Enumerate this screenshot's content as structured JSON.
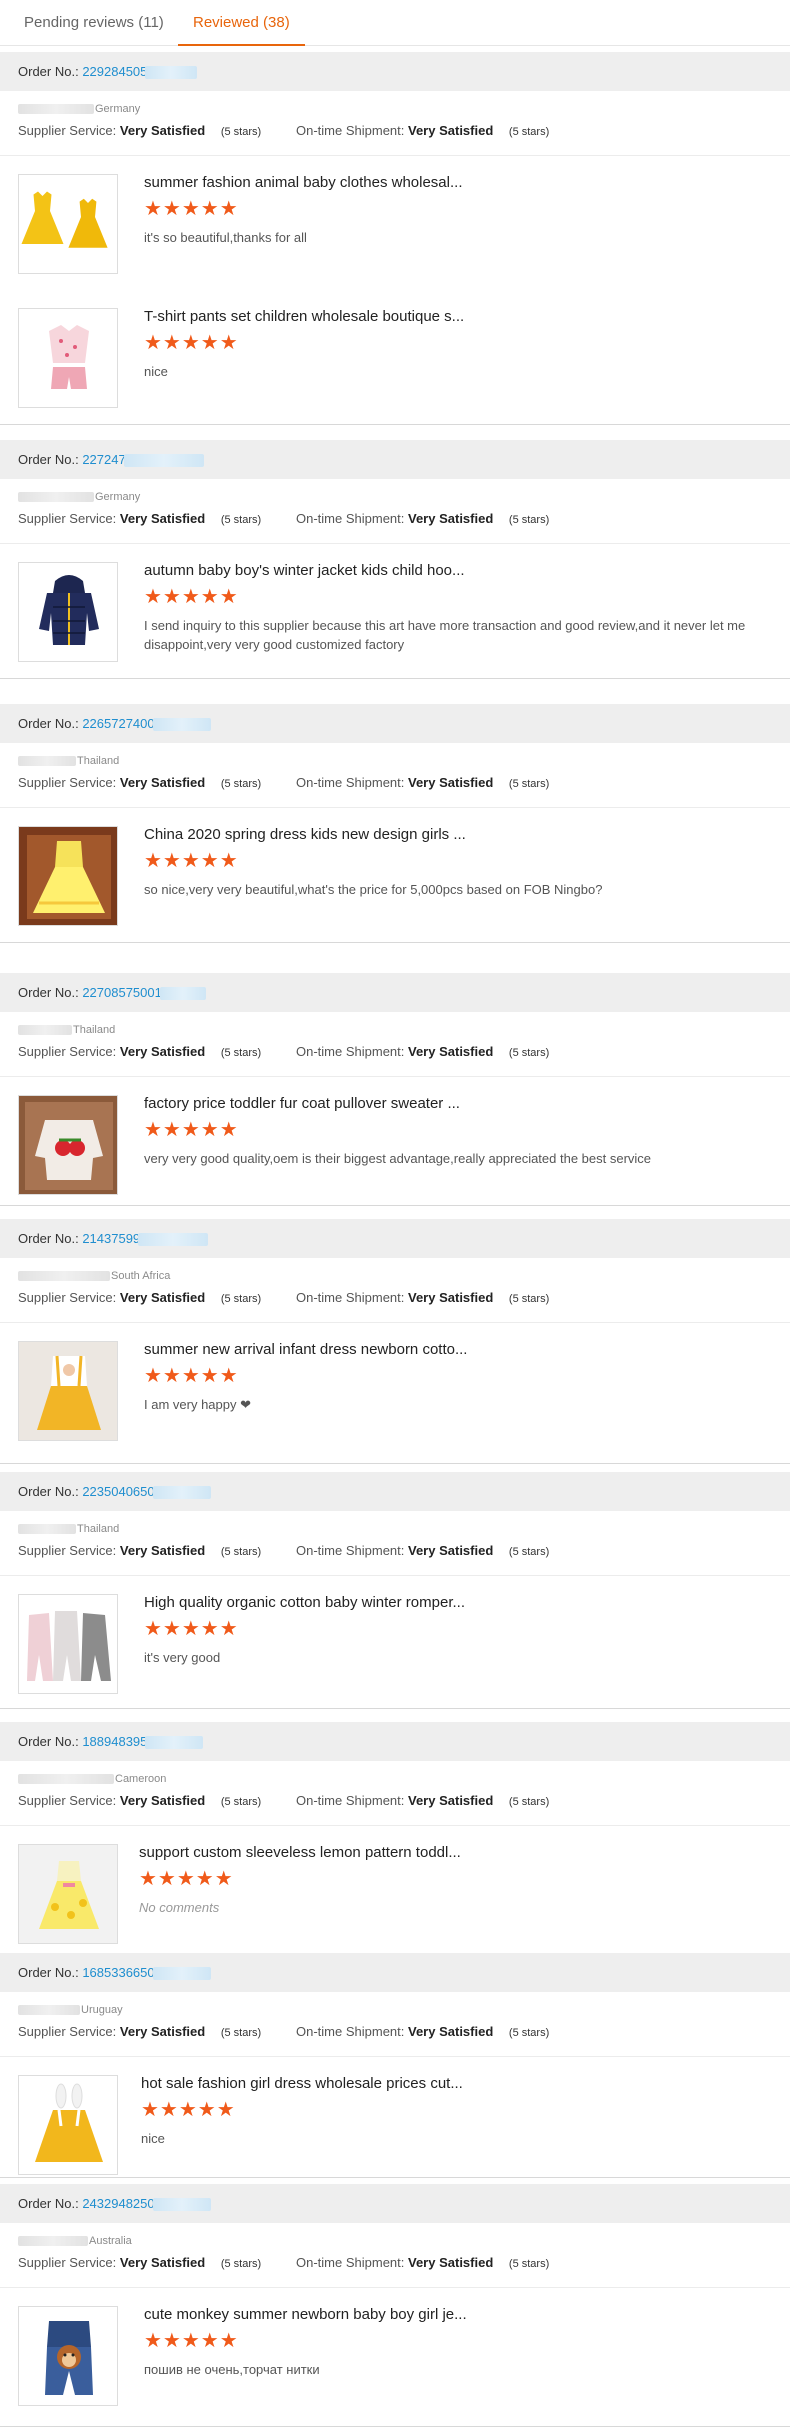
{
  "tabs": {
    "pending": "Pending reviews (11)",
    "reviewed": "Reviewed (38)"
  },
  "labels": {
    "order_no": "Order No.:",
    "supplier_service": "Supplier Service:",
    "shipment": "On-time Shipment:",
    "very_satisfied": "Very Satisfied",
    "five_stars": "(5 stars)"
  },
  "stars": "★★★★★",
  "colors": {
    "accent": "#e8650c",
    "link": "#1f8ecf",
    "star": "#f05a1a"
  },
  "orders": [
    {
      "order_no": "229284505",
      "country": "Germany",
      "items": [
        {
          "title": "summer fashion animal baby clothes wholesal...",
          "comment": "it's so beautiful,thanks for all",
          "image_icon": "yellow-dress-set-icon"
        },
        {
          "title": "T-shirt pants set children wholesale boutique s...",
          "comment": "nice",
          "image_icon": "pink-floral-set-icon"
        }
      ]
    },
    {
      "order_no": "227247",
      "country": "Germany",
      "items": [
        {
          "title": "autumn baby boy's winter jacket kids child hoo...",
          "comment": "I send inquiry to this supplier because this art have more transaction and good review,and it never let me disappoint,very very good customized factory",
          "image_icon": "navy-jacket-icon"
        }
      ]
    },
    {
      "order_no": "2265727400",
      "country": "Thailand",
      "items": [
        {
          "title": "China 2020 spring dress kids new design girls ...",
          "comment": "so nice,very very beautiful,what's the price for 5,000pcs based on FOB Ningbo?",
          "image_icon": "yellow-tulle-dress-icon"
        }
      ]
    },
    {
      "order_no": "22708575001",
      "country": "Thailand",
      "items": [
        {
          "title": "factory price toddler fur coat pullover sweater ...",
          "comment": "very very good quality,oem is their biggest advantage,really appreciated the best service",
          "image_icon": "strawberry-sweater-icon"
        }
      ]
    },
    {
      "order_no": "21437599",
      "country": "South Africa",
      "items": [
        {
          "title": "summer new arrival infant dress newborn cotto...",
          "comment": "I am very happy ❤",
          "image_icon": "yellow-infant-dress-icon"
        }
      ]
    },
    {
      "order_no": "2235040650",
      "country": "Thailand",
      "items": [
        {
          "title": "High quality organic cotton baby winter romper...",
          "comment": "it's very good",
          "image_icon": "rompers-icon"
        }
      ]
    },
    {
      "order_no": "188948395",
      "country": "Cameroon",
      "items": [
        {
          "title": "support custom sleeveless lemon pattern toddl...",
          "comment": "No comments",
          "image_icon": "lemon-dress-icon"
        }
      ]
    },
    {
      "order_no": "1685336650",
      "country": "Uruguay",
      "items": [
        {
          "title": "hot sale fashion girl dress wholesale prices cut...",
          "comment": "nice",
          "image_icon": "bunny-dress-icon"
        }
      ]
    },
    {
      "order_no": "2432948250",
      "country": "Australia",
      "items": [
        {
          "title": "cute monkey summer newborn baby boy girl je...",
          "comment": "пошив не очень,торчат нитки",
          "image_icon": "monkey-overall-icon"
        }
      ]
    }
  ]
}
